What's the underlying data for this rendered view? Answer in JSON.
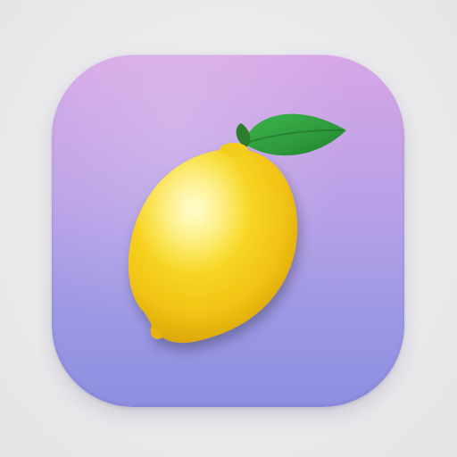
{
  "app_icon": {
    "icon": "lemon-icon",
    "leaf_icon": "leaf-icon",
    "colors": {
      "background_top": "#d6a6e6",
      "background_bottom": "#8e8fe2",
      "lemon": "#f7d31c",
      "leaf": "#2f9a3c",
      "stem": "#2e7d2e"
    }
  }
}
